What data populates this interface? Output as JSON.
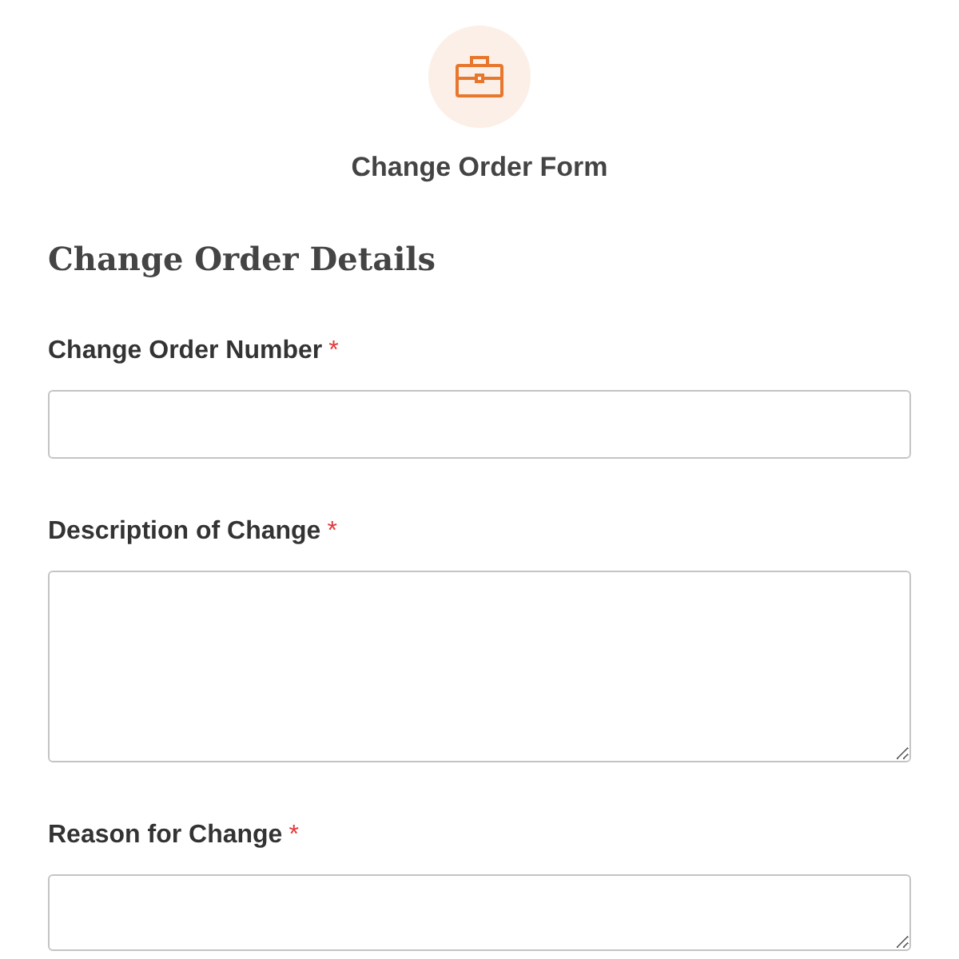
{
  "form_title": "Change Order Form",
  "section_heading": "Change Order Details",
  "fields": [
    {
      "label": "Change Order Number",
      "required": true,
      "kind": "input"
    },
    {
      "label": "Description of Change",
      "required": true,
      "kind": "textarea"
    },
    {
      "label": "Reason for Change",
      "required": true,
      "kind": "textarea"
    }
  ],
  "required_mark": "*"
}
